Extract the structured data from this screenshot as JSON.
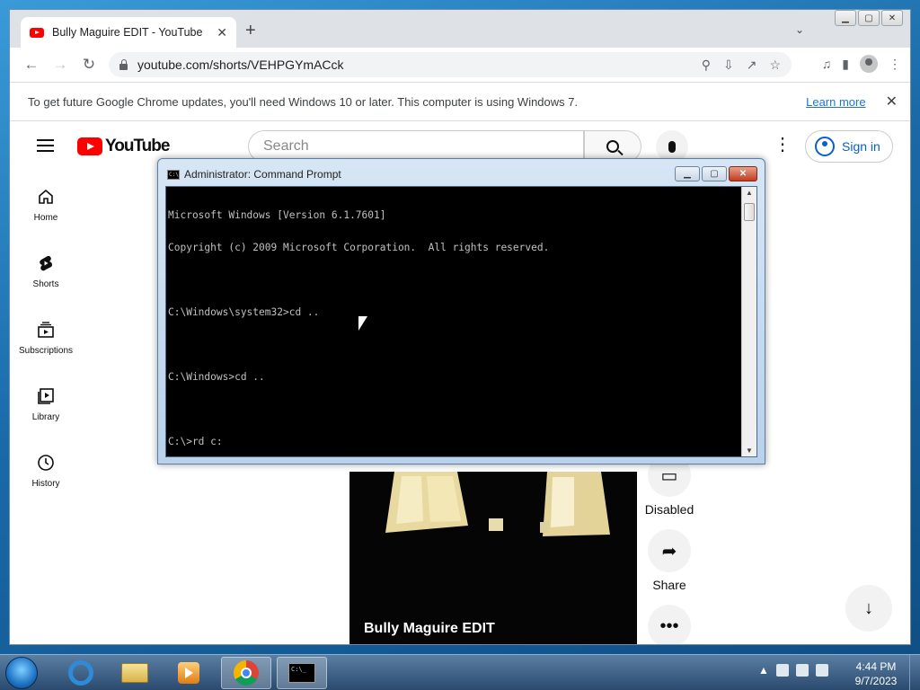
{
  "browser": {
    "tab_title": "Bully Maguire EDIT - YouTube",
    "tab_close": "✕",
    "new_tab": "+",
    "url": "youtube.com/shorts/VEHPGYmACck",
    "infobar": {
      "text": "To get future Google Chrome updates, you'll need Windows 10 or later. This computer is using Windows 7.",
      "link": "Learn more",
      "close": "✕"
    }
  },
  "youtube": {
    "logo_text": "YouTube",
    "search_placeholder": "Search",
    "sign_in": "Sign in",
    "sidebar": [
      {
        "label": "Home",
        "icon": "home-icon"
      },
      {
        "label": "Shorts",
        "icon": "shorts-icon"
      },
      {
        "label": "Subscriptions",
        "icon": "subscriptions-icon"
      },
      {
        "label": "Library",
        "icon": "library-icon"
      },
      {
        "label": "History",
        "icon": "history-icon"
      }
    ],
    "short_title": "Bully Maguire EDIT",
    "actions": [
      {
        "label": "Disabled",
        "icon": "comment-icon"
      },
      {
        "label": "Share",
        "icon": "share-icon"
      },
      {
        "label": "",
        "icon": "more-icon"
      }
    ]
  },
  "cmd": {
    "title": "Administrator: Command Prompt",
    "lines": [
      "Microsoft Windows [Version 6.1.7601]",
      "Copyright (c) 2009 Microsoft Corporation.  All rights reserved.",
      "",
      "C:\\Windows\\system32>cd ..",
      "",
      "C:\\Windows>cd ..",
      "",
      "C:\\>rd c:"
    ]
  },
  "taskbar": {
    "time": "4:44 PM",
    "date": "9/7/2023"
  },
  "colors": {
    "youtube_red": "#ff0000",
    "link_blue": "#1a73e8",
    "signin_blue": "#065fd4"
  }
}
